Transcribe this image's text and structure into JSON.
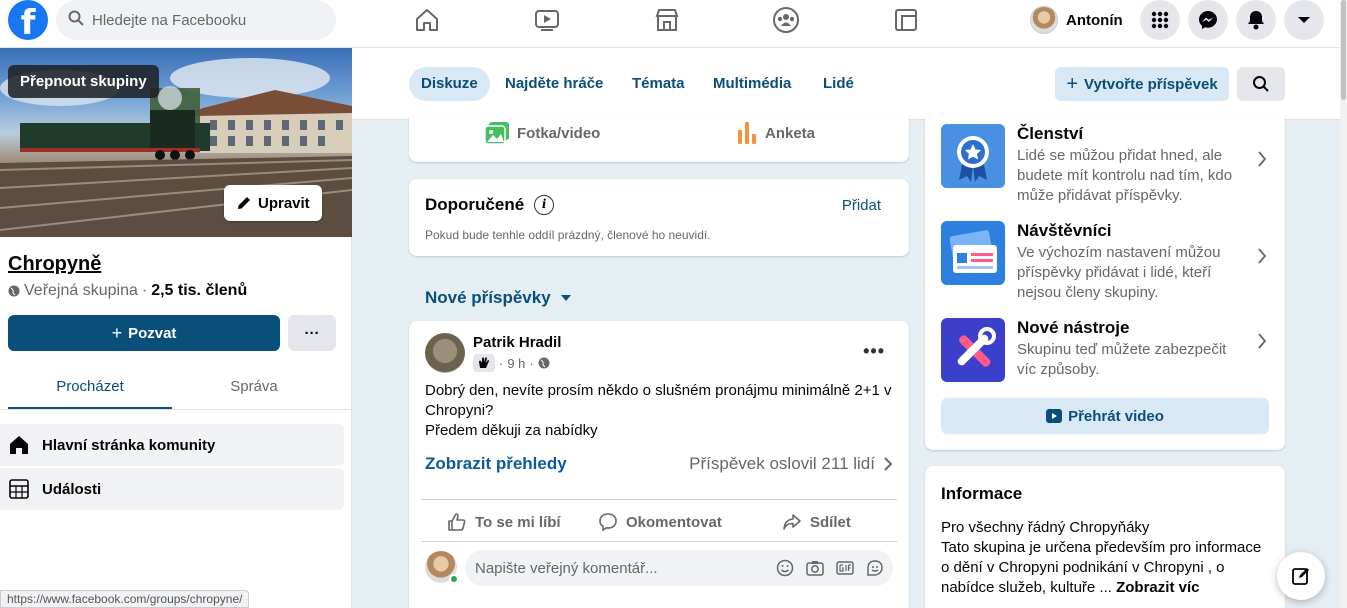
{
  "topbar": {
    "logo": "f",
    "search_placeholder": "Hledejte na Facebooku",
    "nav_icons": [
      "home-icon",
      "watch-icon",
      "marketplace-icon",
      "groups-icon",
      "gaming-icon"
    ],
    "profile_name": "Antonín"
  },
  "left": {
    "switch_groups": "Přepnout skupiny",
    "edit_label": "Upravit",
    "group_name": "Chropyně",
    "privacy": "Veřejná skupina",
    "separator": "·",
    "members": "2,5 tis. členů",
    "invite_label": "Pozvat",
    "more_label": "···",
    "tabs": [
      {
        "label": "Procházet"
      },
      {
        "label": "Správa"
      }
    ],
    "items": [
      {
        "label": "Hlavní stránka komunity"
      },
      {
        "label": "Události"
      }
    ],
    "status_url": "https://www.facebook.com/groups/chropyne/"
  },
  "group_tabs": {
    "tabs": [
      {
        "label": "Diskuze"
      },
      {
        "label": "Najděte hráče"
      },
      {
        "label": "Témata"
      },
      {
        "label": "Multimédia"
      },
      {
        "label": "Lidé"
      }
    ],
    "create_label": "Vytvořte příspěvek"
  },
  "composer": {
    "photo_label": "Fotka/video",
    "poll_label": "Anketa"
  },
  "recommended": {
    "title": "Doporučené",
    "add_label": "Přidat",
    "description": "Pokud bude tenhle oddíl prázdný, členové ho neuvidí."
  },
  "new_posts_label": "Nové příspěvky",
  "post": {
    "author": "Patrik Hradil",
    "time": "9 h",
    "dot": "·",
    "text_line1": "Dobrý den, nevíte prosím někdo o slušném pronájmu minimálně 2+1 v Chropyni?",
    "text_line2": "Předem děkuji za nabídky",
    "insights_label": "Zobrazit přehledy",
    "reach": "Příspěvek oslovil 211 lidí",
    "like_label": "To se mi líbí",
    "comment_label": "Okomentovat",
    "share_label": "Sdílet",
    "comment_placeholder": "Napište veřejný komentář..."
  },
  "right": {
    "features": [
      {
        "title": "Členství",
        "desc": "Lidé se můžou přidat hned, ale budete mít kontrolu nad tím, kdo může přidávat příspěvky."
      },
      {
        "title": "Návštěvníci",
        "desc": "Ve výchozím nastavení můžou příspěvky přidávat i lidé, kteří nejsou členy skupiny."
      },
      {
        "title": "Nové nástroje",
        "desc": "Skupinu teď můžete zabezpečit víc způsoby."
      }
    ],
    "play_label": "Přehrát video",
    "info_title": "Informace",
    "info_line1": "Pro všechny řádný Chropyňáky",
    "info_line2": "Tato skupina je určena především pro informace o dění v Chropyni podnikání v Chropyni , o nabídce služeb, kultuře ... ",
    "info_more": "Zobrazit víc"
  },
  "colors": {
    "primary": "#0a4e7a",
    "facebook_blue": "#1877f2",
    "background": "#e4eef3"
  }
}
